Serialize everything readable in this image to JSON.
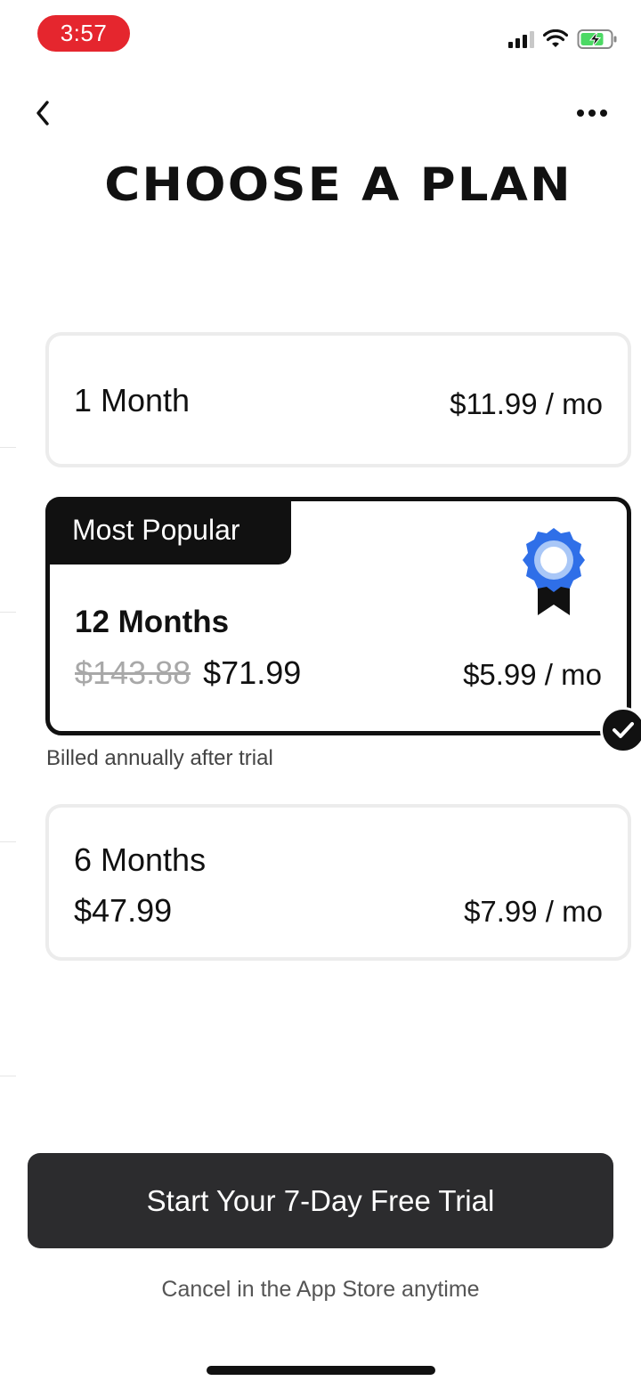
{
  "status_bar": {
    "time": "3:57",
    "icons": [
      "signal-icon",
      "wifi-icon",
      "battery-charging-icon"
    ],
    "pill_color": "#e5262e"
  },
  "nav": {
    "back_icon": "chevron-left-icon",
    "more_icon": "more-horizontal-icon"
  },
  "title": "CHOOSE A PLAN",
  "plans": [
    {
      "name": "1 Month",
      "price_per_month": "$11.99 / mo",
      "selected": false
    },
    {
      "badge": "Most Popular",
      "name": "12 Months",
      "original_price": "$143.88",
      "total_price": "$71.99",
      "price_per_month": "$5.99 / mo",
      "selected": true,
      "icon": "award-ribbon-icon",
      "note": "Billed annually after trial"
    },
    {
      "name": "6 Months",
      "total_price": "$47.99",
      "price_per_month": "$7.99 / mo",
      "selected": false
    }
  ],
  "cta": {
    "label": "Start Your 7-Day Free Trial"
  },
  "footer_note": "Cancel in the App Store anytime",
  "colors": {
    "accent_blue": "#2f6fe8",
    "cta_background": "#2c2c2e",
    "selected_border": "#111111"
  }
}
